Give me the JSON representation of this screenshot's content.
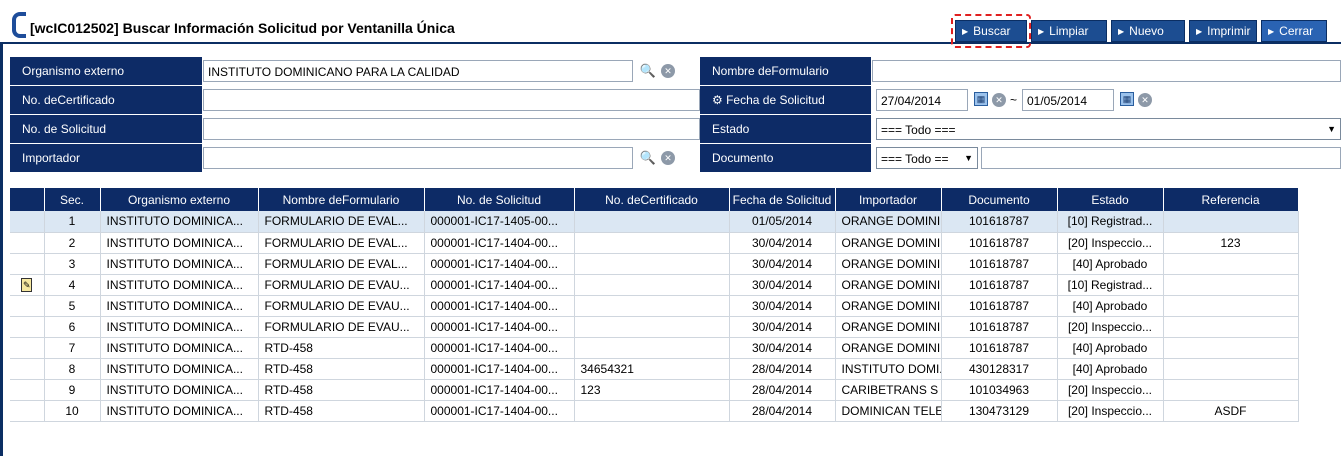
{
  "window": {
    "title": "[wcIC012502] Buscar Información Solicitud por Ventanilla Única"
  },
  "toolbar": {
    "buscar": "Buscar",
    "limpiar": "Limpiar",
    "nuevo": "Nuevo",
    "imprimir": "Imprimir",
    "cerrar": "Cerrar"
  },
  "colors": {
    "header_bg": "#0d2b66",
    "button_bg": "#1c4d91",
    "highlight": "#e02020",
    "selected_row": "#dbe7f3"
  },
  "form": {
    "organismo_label": "Organismo externo",
    "organismo_value": "INSTITUTO DOMINICANO PARA LA CALIDAD",
    "nombre_formulario_label": "Nombre deFormulario",
    "nombre_formulario_value": "",
    "certificado_label": "No. deCertificado",
    "certificado_value": "",
    "fecha_label": "Fecha de Solicitud",
    "fecha_desde": "27/04/2014",
    "fecha_hasta": "01/05/2014",
    "fecha_sep": "~",
    "solicitud_label": "No. de Solicitud",
    "solicitud_value": "",
    "estado_label": "Estado",
    "estado_value": "=== Todo ===",
    "importador_label": "Importador",
    "importador_value": "",
    "documento_label": "Documento",
    "documento_select": "=== Todo ==",
    "documento_value": ""
  },
  "grid": {
    "columns": [
      "Sec.",
      "Organismo externo",
      "Nombre deFormulario",
      "No. de Solicitud",
      "No. deCertificado",
      "Fecha de Solicitud",
      "Importador",
      "Documento",
      "Estado",
      "Referencia"
    ],
    "rows": [
      {
        "sec": "1",
        "org": "INSTITUTO DOMINICA...",
        "form": "FORMULARIO DE EVAL...",
        "sol": "000001-IC17-1405-00...",
        "cert": "",
        "fecha": "01/05/2014",
        "imp": "ORANGE DOMINI...",
        "doc": "101618787",
        "estado": "[10] Registrad...",
        "ref": "",
        "selected": true,
        "edit": false
      },
      {
        "sec": "2",
        "org": "INSTITUTO DOMINICA...",
        "form": "FORMULARIO DE EVAL...",
        "sol": "000001-IC17-1404-00...",
        "cert": "",
        "fecha": "30/04/2014",
        "imp": "ORANGE DOMINI...",
        "doc": "101618787",
        "estado": "[20] Inspeccio...",
        "ref": "123",
        "selected": false,
        "edit": false
      },
      {
        "sec": "3",
        "org": "INSTITUTO DOMINICA...",
        "form": "FORMULARIO DE EVAL...",
        "sol": "000001-IC17-1404-00...",
        "cert": "",
        "fecha": "30/04/2014",
        "imp": "ORANGE DOMINI...",
        "doc": "101618787",
        "estado": "[40] Aprobado",
        "ref": "",
        "selected": false,
        "edit": false
      },
      {
        "sec": "4",
        "org": "INSTITUTO DOMINICA...",
        "form": "FORMULARIO DE EVAU...",
        "sol": "000001-IC17-1404-00...",
        "cert": "",
        "fecha": "30/04/2014",
        "imp": "ORANGE DOMINI...",
        "doc": "101618787",
        "estado": "[10] Registrad...",
        "ref": "",
        "selected": false,
        "edit": true
      },
      {
        "sec": "5",
        "org": "INSTITUTO DOMINICA...",
        "form": "FORMULARIO DE EVAU...",
        "sol": "000001-IC17-1404-00...",
        "cert": "",
        "fecha": "30/04/2014",
        "imp": "ORANGE DOMINI...",
        "doc": "101618787",
        "estado": "[40] Aprobado",
        "ref": "",
        "selected": false,
        "edit": false
      },
      {
        "sec": "6",
        "org": "INSTITUTO DOMINICA...",
        "form": "FORMULARIO DE EVAU...",
        "sol": "000001-IC17-1404-00...",
        "cert": "",
        "fecha": "30/04/2014",
        "imp": "ORANGE DOMINI...",
        "doc": "101618787",
        "estado": "[20] Inspeccio...",
        "ref": "",
        "selected": false,
        "edit": false
      },
      {
        "sec": "7",
        "org": "INSTITUTO DOMINICA...",
        "form": "RTD-458",
        "sol": "000001-IC17-1404-00...",
        "cert": "",
        "fecha": "30/04/2014",
        "imp": "ORANGE DOMINI...",
        "doc": "101618787",
        "estado": "[40] Aprobado",
        "ref": "",
        "selected": false,
        "edit": false
      },
      {
        "sec": "8",
        "org": "INSTITUTO DOMINICA...",
        "form": "RTD-458",
        "sol": "000001-IC17-1404-00...",
        "cert": "34654321",
        "fecha": "28/04/2014",
        "imp": "INSTITUTO DOMI...",
        "doc": "430128317",
        "estado": "[40] Aprobado",
        "ref": "",
        "selected": false,
        "edit": false
      },
      {
        "sec": "9",
        "org": "INSTITUTO DOMINICA...",
        "form": "RTD-458",
        "sol": "000001-IC17-1404-00...",
        "cert": "123",
        "fecha": "28/04/2014",
        "imp": "CARIBETRANS S A",
        "doc": "101034963",
        "estado": "[20] Inspeccio...",
        "ref": "",
        "selected": false,
        "edit": false
      },
      {
        "sec": "10",
        "org": "INSTITUTO DOMINICA...",
        "form": "RTD-458",
        "sol": "000001-IC17-1404-00...",
        "cert": "",
        "fecha": "28/04/2014",
        "imp": "DOMINICAN TELE...",
        "doc": "130473129",
        "estado": "[20] Inspeccio...",
        "ref": "ASDF",
        "selected": false,
        "edit": false
      }
    ]
  }
}
